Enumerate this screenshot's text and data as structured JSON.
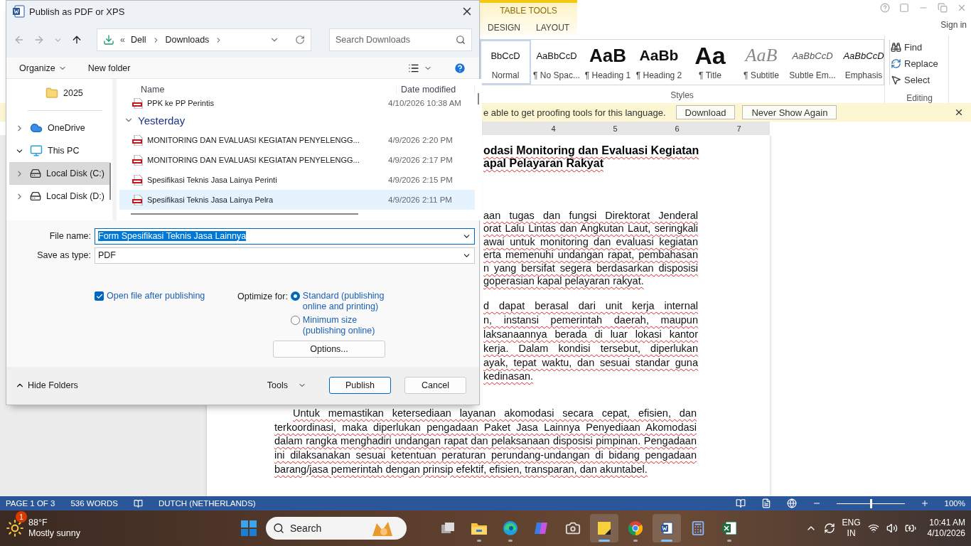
{
  "word": {
    "contextual_group": "TABLE TOOLS",
    "ribbon_tabs": [
      {
        "label": "DESIGN",
        "selected": false
      },
      {
        "label": "LAYOUT",
        "selected": false
      }
    ],
    "sign_in": "Sign in",
    "styles": [
      {
        "kind": "normal",
        "preview": "BbCcD",
        "name": "Normal",
        "selected": true
      },
      {
        "kind": "nospacing",
        "preview": "AaBbCcD",
        "name": "¶ No Spac...",
        "selected": false
      },
      {
        "kind": "heading1",
        "preview": "AaB",
        "name": "¶ Heading 1",
        "selected": false
      },
      {
        "kind": "heading2",
        "preview": "AaBb",
        "name": "¶ Heading 2",
        "selected": false
      },
      {
        "kind": "title",
        "preview": "Aa",
        "name": "¶ Title",
        "selected": false
      },
      {
        "kind": "subtitle",
        "preview": "AaB",
        "name": "¶ Subtitle",
        "selected": false
      },
      {
        "kind": "subtle",
        "preview": "AaBbCcD",
        "name": "Subtle Em...",
        "selected": false
      },
      {
        "kind": "emphasis",
        "preview": "AaBbCcD",
        "name": "Emphasis",
        "selected": false
      }
    ],
    "styles_label": "Styles",
    "editing": [
      {
        "kind": "find",
        "label": "Find"
      },
      {
        "kind": "replace",
        "label": "Replace"
      },
      {
        "kind": "select",
        "label": "Select"
      }
    ],
    "editing_label": "Editing",
    "message_bar": {
      "text": "e able to get proofing tools for this language.",
      "buttons": [
        "Download",
        "Never Show Again"
      ]
    },
    "ruler": [
      "4",
      "5",
      "6",
      "7"
    ],
    "document": {
      "heading": [
        "odasi Monitoring dan Evaluasi Kegiatan",
        "apal Pelayaran Rakyat"
      ],
      "fragments": [
        [
          "aan tugas dan fungsi Direktorat Jenderal",
          "orat Lalu Lintas dan Angkutan Laut, seringkali",
          "awai untuk monitoring dan evaluasi kegiatan",
          "erta memenuhi undangan rapat, pembahasan",
          "n yang bersifat segera berdasarkan disposisi",
          "goperasian kapal pelayaran rakyat."
        ],
        [
          "d dapat berasal dari unit kerja internal",
          "n, instansi pemerintah daerah, maupun",
          "laksanaannya berada di luar lokasi kantor",
          "kerja. Dalam kondisi tersebut, diperlukan",
          "ayak, tepat waktu, dan sesuai standar guna",
          "kedinasan."
        ]
      ],
      "paragraph": "Untuk memastikan ketersediaan layanan akomodasi secara cepat, efisien, dan terkoordinasi, maka diperlukan pengadaan Paket Jasa Lainnya Penyediaan Akomodasi dalam rangka menghadiri undangan rapat dan pelaksanaan disposisi pimpinan. Pengadaan ini dilaksanakan sesuai ketentuan peraturan perundang-undangan di bidang pengadaan barang/jasa pemerintah dengan prinsip efektif, efisien, transparan, dan akuntabel."
    },
    "status_bar": {
      "page": "PAGE 1 OF 3",
      "words": "536 WORDS",
      "language": "DUTCH (NETHERLANDS)",
      "zoom": {
        "level": 0.5
      },
      "zoom_reading": "100%"
    }
  },
  "dialog": {
    "title": "Publish as PDF or XPS",
    "path_prefix": "«",
    "breadcrumb": [
      "Dell",
      "Downloads"
    ],
    "search": {
      "placeholder": "Search Downloads"
    },
    "toolbar": [
      "Organize",
      "New folder"
    ],
    "nav": [
      {
        "kind": "folder",
        "label": "2025",
        "selected": false
      },
      {
        "kind": "cloud",
        "label": "OneDrive",
        "expanded": false,
        "selected": false
      },
      {
        "kind": "pc",
        "label": "This PC",
        "expanded": true,
        "selected": false,
        "children": [
          {
            "kind": "disk",
            "label": "Local Disk (C:)",
            "expanded": false,
            "selected": true
          },
          {
            "kind": "disk",
            "label": "Local Disk (D:)",
            "expanded": false,
            "selected": false
          }
        ]
      }
    ],
    "columns": [
      "Name",
      "Date modified"
    ],
    "top_rows": [
      {
        "name": "PPK ke PP Perintis",
        "date": "4/10/2026 10:38 AM",
        "selected": false
      }
    ],
    "group": {
      "label": "Yesterday",
      "expanded": true,
      "rows": [
        {
          "name": "MONITORING DAN EVALUASI KEGIATAN PENYELENGG...",
          "date": "4/9/2026 2:20 PM",
          "selected": false
        },
        {
          "name": "MONITORING DAN EVALUASI KEGIATAN PENYELENGG...",
          "date": "4/9/2026 2:17 PM",
          "selected": false
        },
        {
          "name": "Spesifikasi Teknis Jasa Lainya Perinti",
          "date": "4/9/2026 2:15 PM",
          "selected": false
        },
        {
          "name": "Spesifikasi Teknis Jasa Lainya Pelra",
          "date": "4/9/2026 2:11 PM",
          "selected": true
        }
      ]
    },
    "file_name": {
      "label": "File name:",
      "value": "Form Spesifikasi Teknis Jasa Lainnya"
    },
    "save_type": {
      "label": "Save as type:",
      "value": "PDF"
    },
    "open_after": {
      "label": "Open file after publishing",
      "checked": true
    },
    "optimize_label": "Optimize for:",
    "optimize": [
      {
        "label": "Standard (publishing online and printing)",
        "selected": true
      },
      {
        "label": "Minimum size (publishing online)",
        "selected": false
      }
    ],
    "options_button": "Options...",
    "hide_folders": "Hide Folders",
    "tools": "Tools",
    "publish": "Publish",
    "cancel": "Cancel"
  },
  "taskbar": {
    "weather": {
      "badge": "1",
      "temp": "88°F",
      "text": "Mostly sunny"
    },
    "search": "Search",
    "apps": [
      {
        "kind": "taskview",
        "running": false,
        "active": false
      },
      {
        "kind": "explorer",
        "running": true,
        "active": false
      },
      {
        "kind": "edge",
        "running": true,
        "active": false
      },
      {
        "kind": "copilot",
        "running": false,
        "active": false
      },
      {
        "kind": "camera",
        "running": false,
        "active": false
      },
      {
        "kind": "notes",
        "running": true,
        "active": true
      },
      {
        "kind": "chrome",
        "running": true,
        "active": false
      },
      {
        "kind": "word",
        "running": true,
        "active": true
      },
      {
        "kind": "calculator",
        "running": false,
        "active": false
      },
      {
        "kind": "excel",
        "running": true,
        "active": false
      }
    ],
    "language": [
      "ENG",
      "IN"
    ],
    "time": "10:41 AM",
    "date": "4/10/2026"
  }
}
